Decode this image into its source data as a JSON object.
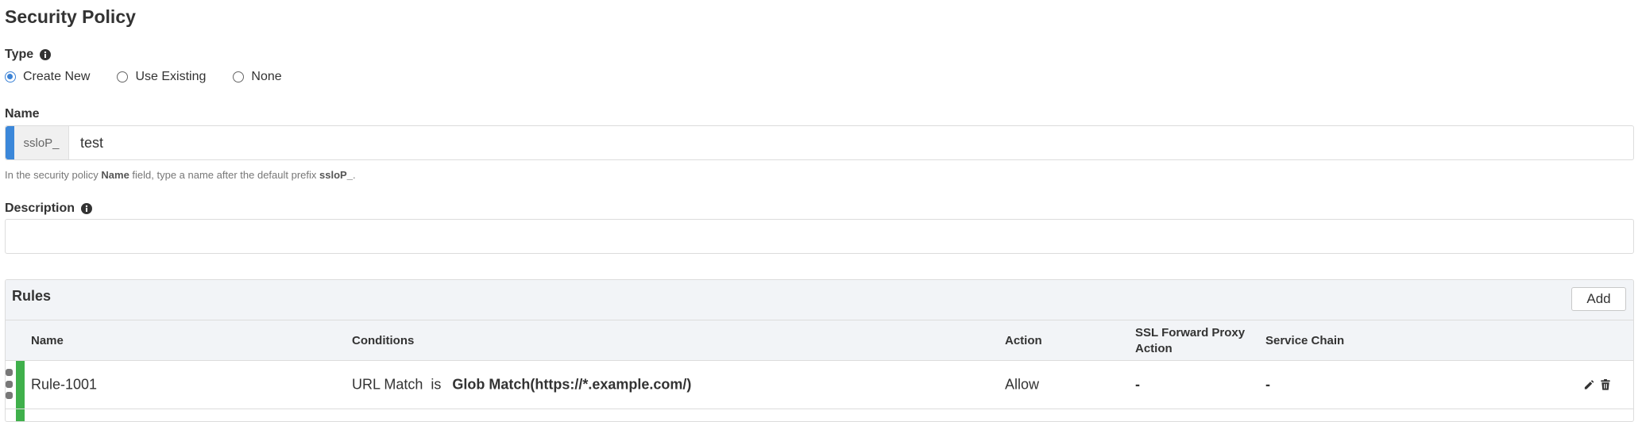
{
  "page": {
    "title": "Security Policy"
  },
  "type": {
    "label": "Type",
    "options": [
      {
        "label": "Create New",
        "checked": true
      },
      {
        "label": "Use Existing",
        "checked": false
      },
      {
        "label": "None",
        "checked": false
      }
    ]
  },
  "name": {
    "label": "Name",
    "prefix": "ssloP_",
    "value": "test",
    "hint_1": "In the security policy ",
    "hint_bold_1": "Name",
    "hint_2": " field, type a name after the default prefix ",
    "hint_bold_2": "ssloP_",
    "hint_3": "."
  },
  "description": {
    "label": "Description",
    "value": ""
  },
  "rules": {
    "title": "Rules",
    "add_label": "Add",
    "columns": {
      "name": "Name",
      "conditions": "Conditions",
      "action": "Action",
      "ssl_line1": "SSL Forward Proxy",
      "ssl_line2": "Action",
      "service_chain": "Service Chain"
    },
    "rows": [
      {
        "name": "Rule-1001",
        "condition_prefix": "URL Match  is",
        "condition_value": "Glob Match(https://*.example.com/)",
        "action": "Allow",
        "ssl_action": "-",
        "service_chain": "-"
      }
    ]
  },
  "colors": {
    "accent_blue": "#3b87d9",
    "rule_green": "#3fb04b"
  },
  "icons": [
    "info-icon",
    "pencil-icon",
    "trash-icon",
    "drag-handle-icon"
  ]
}
